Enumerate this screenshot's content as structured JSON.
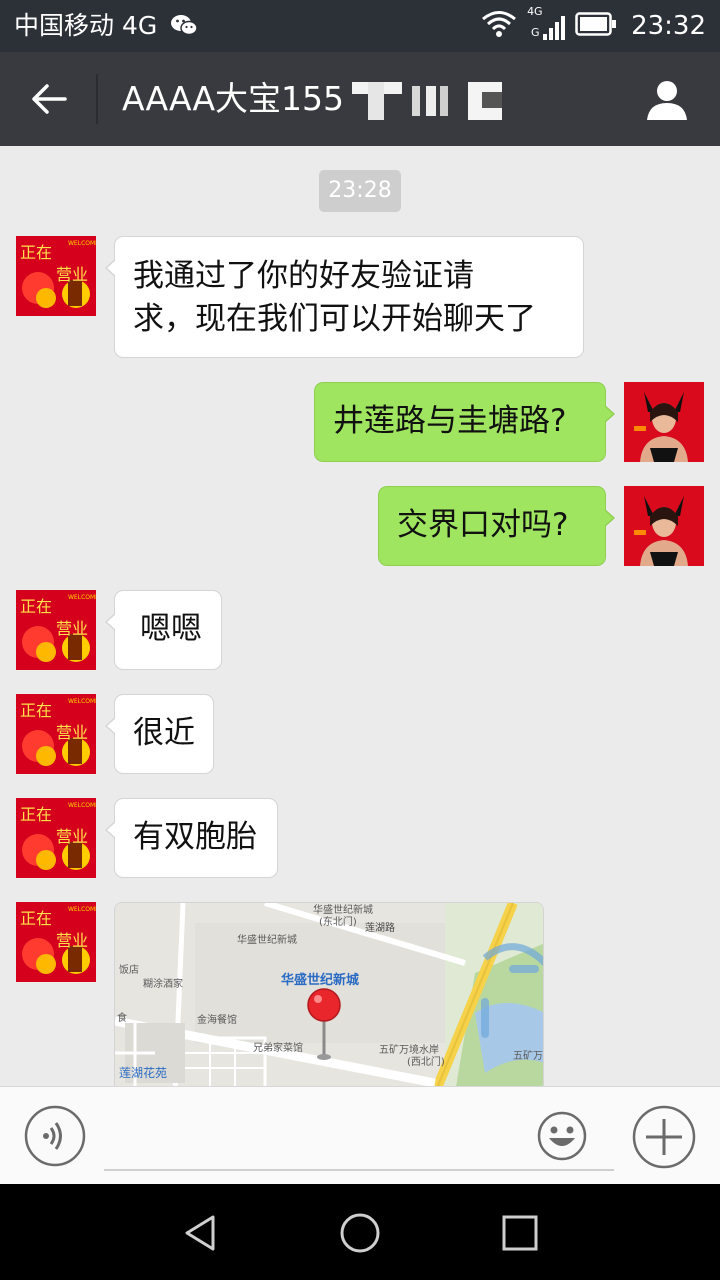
{
  "status_bar": {
    "carrier": "中国移动 4G",
    "time": "23:32",
    "network_badge": "4G",
    "icons": [
      "wechat-icon",
      "wifi-icon",
      "signal-icon",
      "battery-icon"
    ]
  },
  "header": {
    "title": "AAAA大宝155",
    "icons": [
      "back-arrow-icon",
      "profile-icon"
    ]
  },
  "chat": {
    "timestamp": "23:28",
    "messages": [
      {
        "side": "in",
        "text": "我通过了你的好友验证请求，现在我们可以开始聊天了",
        "line1": "我通过了你的好友验证请",
        "line2": "求，现在我们可以开始聊天了"
      },
      {
        "side": "out",
        "text": "井莲路与圭塘路?"
      },
      {
        "side": "out",
        "text": "交界口对吗?"
      },
      {
        "side": "in",
        "text": "嗯嗯"
      },
      {
        "side": "in",
        "text": "很近"
      },
      {
        "side": "in",
        "text": "有双胞胎"
      },
      {
        "side": "in",
        "type": "location"
      }
    ],
    "avatar_contact": {
      "top_text": "WELCOME",
      "line1": "正在",
      "line2": "营业"
    },
    "map": {
      "title": "华盛世纪新城",
      "labels": [
        "华盛世纪新城",
        "(东北门)",
        "莲湖路",
        "华盛世纪新城",
        "饭店",
        "糊涂酒家",
        "金海餐馆",
        "兄弟家菜馆",
        "五矿万境水岸",
        "(西北门)",
        "五矿万",
        "莲湖花苑",
        "食"
      ]
    }
  },
  "input_bar": {
    "placeholder": "",
    "icons": [
      "voice-icon",
      "emoji-icon",
      "plus-icon"
    ]
  },
  "nav_bar": {
    "icons": [
      "back-triangle-icon",
      "home-circle-icon",
      "recents-square-icon"
    ]
  },
  "colors": {
    "status_bar_bg": "#2b3137",
    "title_bar_bg": "#393a3f",
    "chat_bg": "#ebebeb",
    "bubble_out": "#9fe55f",
    "bubble_in": "#ffffff",
    "timestamp_bg": "#cecece",
    "pin_red": "#e8262b"
  }
}
